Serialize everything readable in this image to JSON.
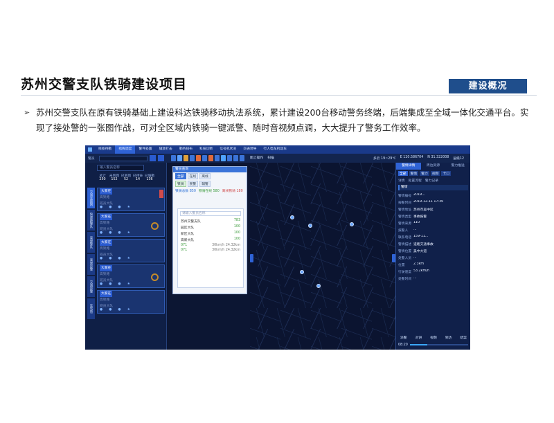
{
  "slide": {
    "title": "苏州交警支队铁骑建设项目",
    "section": "建设概况",
    "bullet": "➢",
    "description": "苏州交警支队在原有铁骑基础上建设科达铁骑移动执法系统，累计建设200台移动警务终端，后端集成至全域一体化交通平台。实现了接处警的一张图作战，可对全区域内铁骑一键派警、随时音视频点调，大大提升了警务工作效率。"
  },
  "app": {
    "nav": [
      "统揽待勤",
      "指挥调度",
      "警件处置",
      "辅放打击",
      "勤务排布",
      "科技诊断",
      "信号机状况",
      "交通诱导",
      "行人电车机动车"
    ],
    "active_nav_index": 1,
    "search_label": "警员",
    "map_tools": [
      "图上操作",
      "扫描"
    ],
    "coords": [
      "多云 19~29℃",
      "E 120.586704",
      "N 31.322008",
      "层级12"
    ],
    "left": {
      "search_placeholder": "输入警员名称",
      "stat_labels": [
        "总计",
        "未到岗",
        "已到岗",
        "已待命",
        "已值勤"
      ],
      "stat_values": [
        "250",
        "152",
        "52",
        "14",
        "136"
      ],
      "vtabs": [
        "交通主题网",
        "快速路警队",
        "高速警队",
        "高速巡警",
        "交通巡警",
        "车驾管"
      ],
      "cards": [
        {
          "tag": "大家在",
          "name": "高架路",
          "sub": "班员大队"
        },
        {
          "tag": "大家在",
          "name": "高架路",
          "sub": "班员大队"
        },
        {
          "tag": "大家在",
          "name": "高架路",
          "sub": "班员大队"
        },
        {
          "tag": "大家在",
          "name": "高架路",
          "sub": "班员大队"
        },
        {
          "tag": "大家在",
          "name": "高架路",
          "sub": "班员大队"
        }
      ]
    },
    "popup": {
      "title": "警员查询",
      "chips_row1": [
        "全部",
        "在线",
        "离线"
      ],
      "chips_row2": [
        "铁骑",
        "民警",
        "辅警"
      ],
      "stats": [
        "铁骑总数 850",
        "铁骑在线 580",
        "离线铁骑 180"
      ],
      "search_placeholder": "请输入警员名称",
      "tree": [
        {
          "name": "苏州交警支队",
          "value": "783",
          "mark": ""
        },
        {
          "name": "园区大队",
          "value": "100",
          "mark": ""
        },
        {
          "name": "新区大队",
          "value": "100",
          "mark": ""
        },
        {
          "name": "高新大队",
          "value": "100",
          "mark": ""
        },
        {
          "name": "",
          "value": "071",
          "mark": "30km/h 24.32km"
        },
        {
          "name": "",
          "value": "071",
          "mark": "30km/h 24.32km"
        }
      ]
    },
    "right": {
      "tabs": [
        "警情详情",
        "周边资源",
        "警力推送"
      ],
      "chips": [
        "全部",
        "警情",
        "警力",
        "视频",
        "卡口"
      ],
      "sub_tabs": [
        "详情",
        "处置流程",
        "警力记录"
      ],
      "section": "警情",
      "fields": [
        {
          "k": "警情编号",
          "v": "2019..."
        },
        {
          "k": "报警时间",
          "v": "2019-12-11 17:36"
        },
        {
          "k": "警情地址",
          "v": "苏州市吴中区"
        },
        {
          "k": "警情类型",
          "v": "事故报警"
        },
        {
          "k": "警情来源",
          "v": "110"
        },
        {
          "k": "报警人",
          "v": "..."
        },
        {
          "k": "联系电话",
          "v": "159-11..."
        },
        {
          "k": "警情描述",
          "v": "道路交通事故"
        },
        {
          "k": "警情位置",
          "v": "吴中大道"
        }
      ],
      "extra": [
        {
          "k": "处警人员",
          "v": "..."
        },
        {
          "k": "位置",
          "v": "2.3km"
        },
        {
          "k": "行驶速度",
          "v": "53.2km/h"
        },
        {
          "k": "处警时间",
          "v": "..."
        }
      ],
      "bottom": [
        "派警",
        "对讲",
        "视频",
        "到达",
        "结案"
      ],
      "time": "08:20",
      "progress": 0.3
    }
  }
}
